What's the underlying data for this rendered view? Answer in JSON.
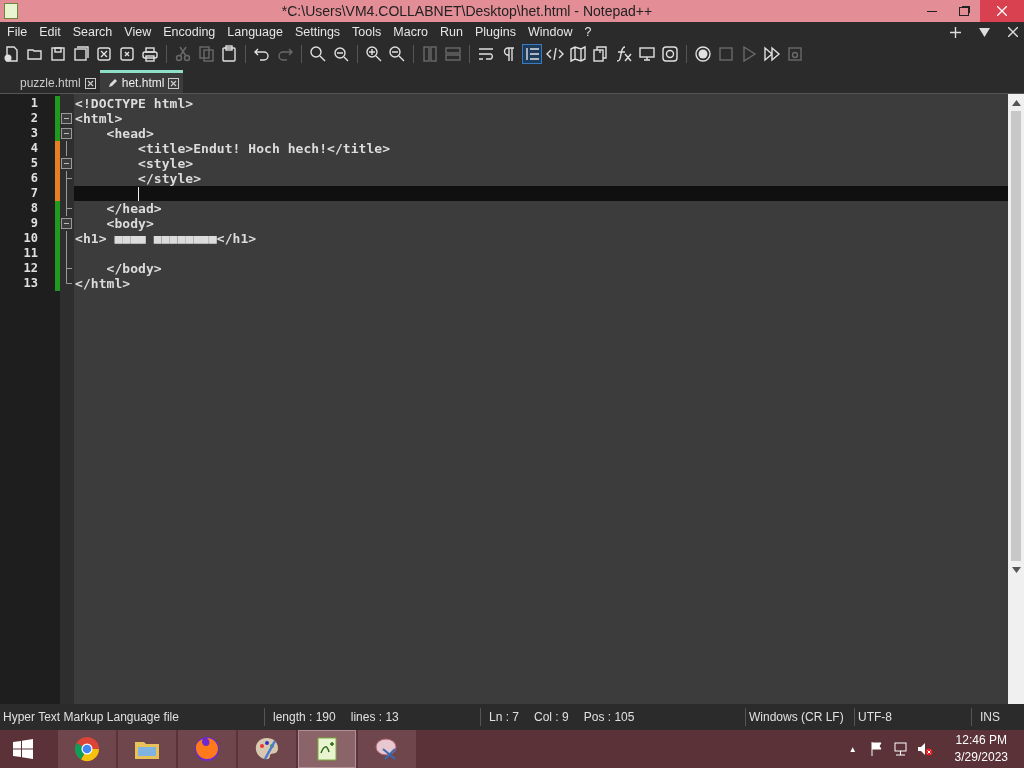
{
  "window": {
    "title": "*C:\\Users\\VM4.COLLABNET\\Desktop\\het.html - Notepad++"
  },
  "menu": [
    "File",
    "Edit",
    "Search",
    "View",
    "Encoding",
    "Language",
    "Settings",
    "Tools",
    "Macro",
    "Run",
    "Plugins",
    "Window",
    "?"
  ],
  "toolbar": [
    {
      "disabled": false
    },
    {
      "disabled": false
    },
    {
      "disabled": false
    },
    {
      "disabled": false
    },
    {
      "disabled": false
    },
    {
      "disabled": false
    },
    {
      "disabled": false
    },
    {
      "disabled": true
    },
    {
      "disabled": true
    },
    {
      "disabled": false
    },
    {
      "disabled": false
    },
    {
      "disabled": true
    },
    {
      "disabled": false
    },
    {
      "disabled": false
    },
    {
      "disabled": false
    },
    {
      "disabled": false
    },
    {
      "disabled": true
    },
    {
      "disabled": true
    },
    {
      "disabled": false
    },
    {
      "disabled": false
    },
    {
      "disabled": false,
      "selected": true
    },
    {
      "disabled": false
    },
    {
      "disabled": false
    },
    {
      "disabled": false
    },
    {
      "disabled": false
    },
    {
      "disabled": false
    },
    {
      "disabled": false
    },
    {
      "disabled": false
    },
    {
      "disabled": true
    },
    {
      "disabled": true
    },
    {
      "disabled": false
    },
    {
      "disabled": true
    }
  ],
  "tabs": [
    {
      "label": "puzzle.html",
      "selected": false,
      "modified": false
    },
    {
      "label": "het.html",
      "selected": true,
      "modified": true
    }
  ],
  "editor": {
    "lines": [
      {
        "number": "1",
        "text": "<!DOCTYPE html>",
        "modified": false,
        "kind": "plain",
        "current": false
      },
      {
        "number": "2",
        "text": "<html>",
        "modified": false,
        "kind": "fold_start",
        "current": false
      },
      {
        "number": "3",
        "text": "    <head>",
        "modified": false,
        "kind": "fold_start",
        "current": false
      },
      {
        "number": "4",
        "text": "        <title>Endut! Hoch hech!</title>",
        "modified": true,
        "kind": "fold_body",
        "current": false
      },
      {
        "number": "5",
        "text": "        <style>",
        "modified": true,
        "kind": "fold_start",
        "current": false
      },
      {
        "number": "6",
        "text": "        </style>",
        "modified": true,
        "kind": "fold_end",
        "current": false
      },
      {
        "number": "7",
        "modified": true,
        "kind": "fold_body",
        "current": true
      },
      {
        "number": "8",
        "text": "    </head>",
        "modified": false,
        "kind": "fold_end",
        "current": false
      },
      {
        "number": "9",
        "text": "    <body>",
        "modified": false,
        "kind": "fold_start",
        "current": false
      },
      {
        "number": "10",
        "text": "<h1> ■■■■ ■■■■■■■■</h1>",
        "modified": false,
        "kind": "fold_body",
        "current": false
      },
      {
        "number": "11",
        "modified": false,
        "kind": "fold_body",
        "current": false
      },
      {
        "number": "12",
        "text": "    </body>",
        "modified": false,
        "kind": "fold_end",
        "current": false
      },
      {
        "number": "13",
        "text": "</html>",
        "modified": false,
        "kind": "fold_last",
        "current": false
      }
    ]
  },
  "status_bar": {
    "file_type": "Hyper Text Markup Language file",
    "length": "length : 190",
    "lines": "lines : 13",
    "ln": "Ln : 7",
    "col": "Col : 9",
    "pos": "Pos : 105",
    "eol": "Windows (CR LF)",
    "encoding": "UTF-8",
    "mode": "INS"
  },
  "taskbar": {
    "apps": [
      {
        "active": false
      },
      {
        "active": false
      },
      {
        "active": false
      },
      {
        "active": false
      },
      {
        "active": true
      },
      {
        "active": false
      }
    ],
    "tray_arrow": "▲",
    "time": "12:46 PM",
    "date": "3/29/2023"
  }
}
